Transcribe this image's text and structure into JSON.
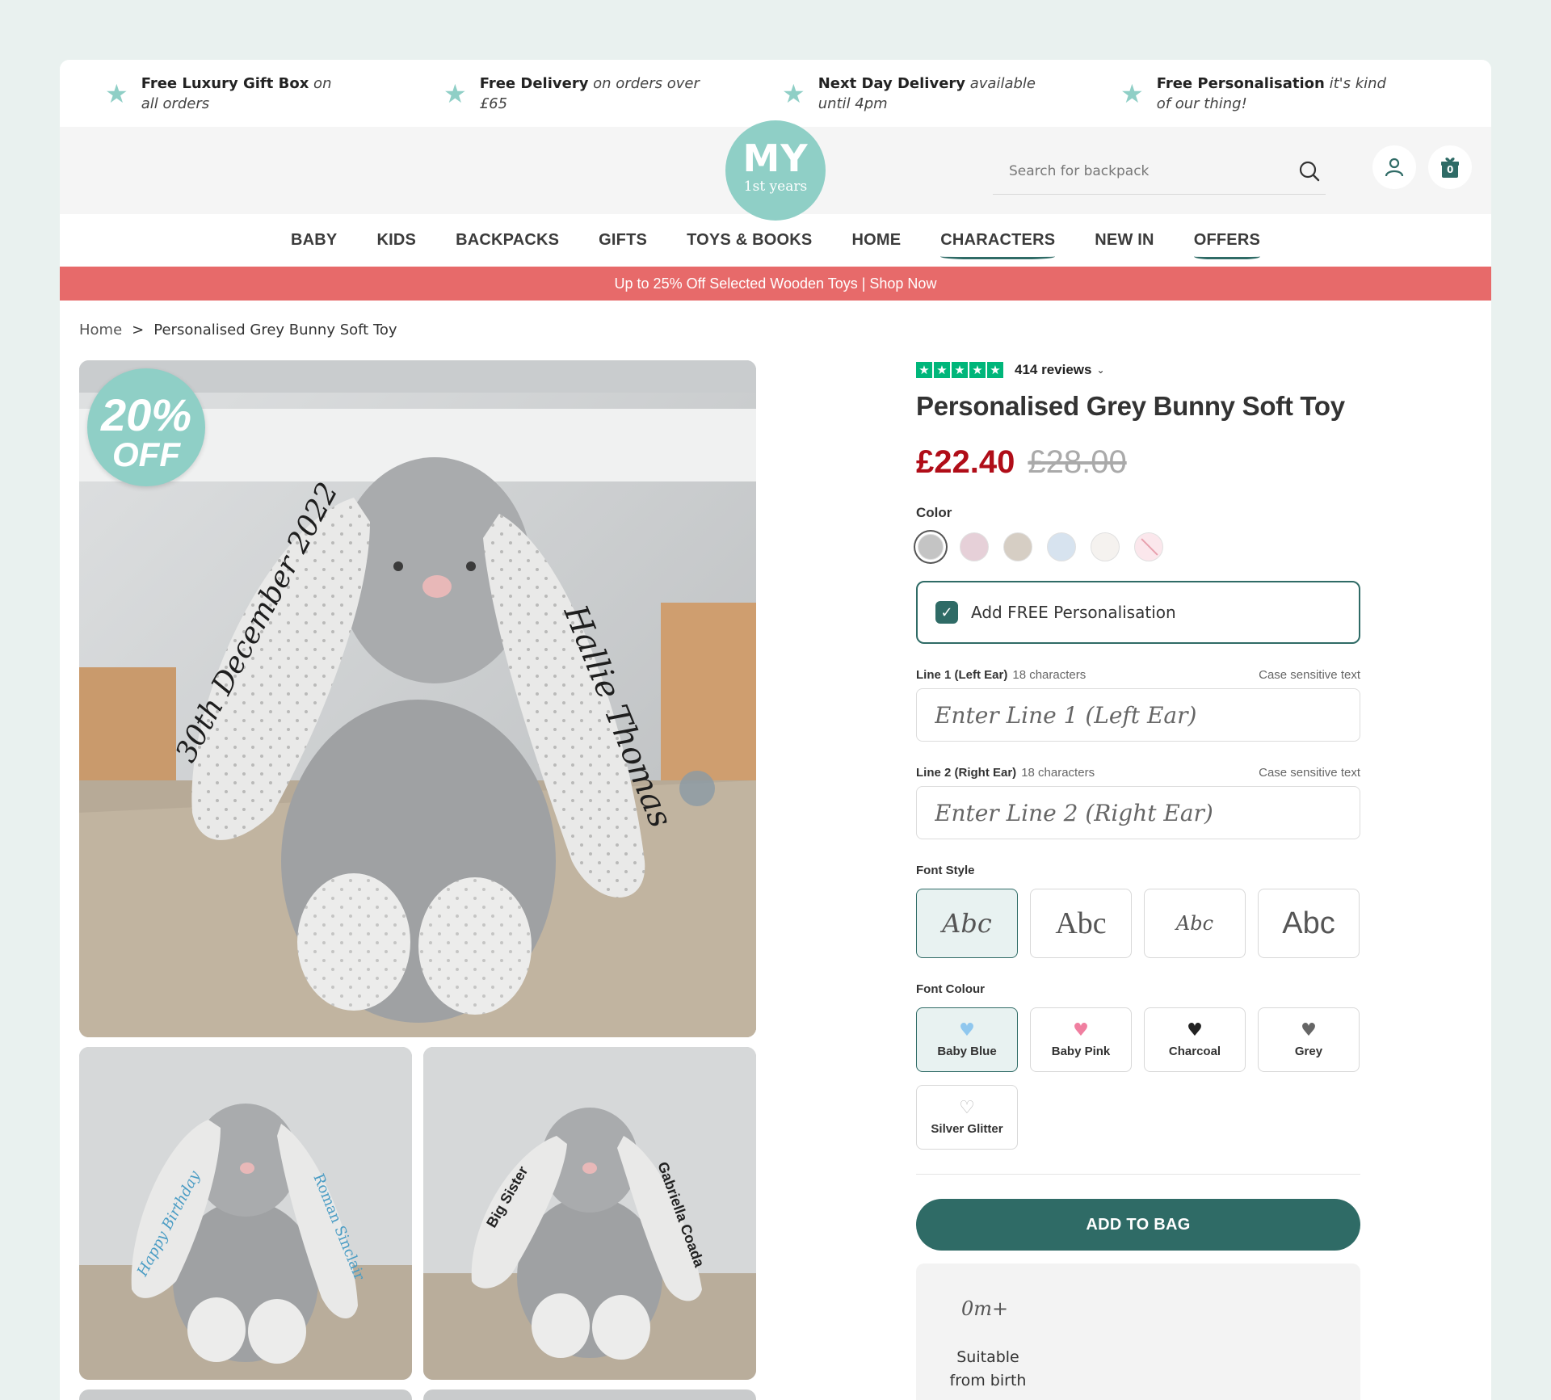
{
  "usps": [
    {
      "bold": "Free Luxury Gift Box",
      "rest": " on all orders"
    },
    {
      "bold": "Free Delivery",
      "rest": " on orders over £65"
    },
    {
      "bold": "Next Day Delivery",
      "rest": " available until 4pm"
    },
    {
      "bold": "Free Personalisation",
      "rest": " it's kind of our thing!"
    }
  ],
  "logo": {
    "big": "MY",
    "small": "1st years"
  },
  "search": {
    "placeholder": "Search for backpack"
  },
  "header": {
    "cart_count": "0"
  },
  "nav": [
    "BABY",
    "KIDS",
    "BACKPACKS",
    "GIFTS",
    "TOYS & BOOKS",
    "HOME",
    "CHARACTERS",
    "NEW IN",
    "OFFERS"
  ],
  "promo": "Up to 25% Off Selected Wooden Toys | Shop Now",
  "breadcrumb": {
    "home": "Home",
    "sep": ">",
    "current": "Personalised Grey Bunny Soft Toy"
  },
  "badge": {
    "pct": "20%",
    "off": "OFF"
  },
  "gallery": {
    "main_left_ear": "30th December 2022",
    "main_right_ear": "Hallie Thomas",
    "thumb1_left": "Happy Birthday",
    "thumb1_right": "Roman Sinclair",
    "thumb2_left": "Big Sister",
    "thumb2_right": "Gabriella Coada"
  },
  "product": {
    "reviews": "414 reviews",
    "title": "Personalised Grey Bunny Soft Toy",
    "price_now": "£22.40",
    "price_was": "£28.00",
    "color_label": "Color",
    "swatches": [
      "#c4c4c4",
      "#e6d0d8",
      "#d6cec4",
      "#d7e3ef",
      "#f5f2ef",
      "#fbe7ec"
    ],
    "personalise_label": "Add FREE Personalisation",
    "line1": {
      "label": "Line 1 (Left Ear)",
      "chars": "18 characters",
      "note": "Case sensitive text",
      "placeholder": "Enter Line 1 (Left Ear)"
    },
    "line2": {
      "label": "Line 2 (Right Ear)",
      "chars": "18 characters",
      "note": "Case sensitive text",
      "placeholder": "Enter Line 2 (Right Ear)"
    },
    "font_style_label": "Font Style",
    "font_styles": [
      "Abc",
      "Abc",
      "Abc",
      "Abc"
    ],
    "font_colour_label": "Font Colour",
    "font_colours": [
      {
        "name": "Baby Blue",
        "color": "#8fc7ee"
      },
      {
        "name": "Baby Pink",
        "color": "#f07fa0"
      },
      {
        "name": "Charcoal",
        "color": "#222222"
      },
      {
        "name": "Grey",
        "color": "#666666"
      },
      {
        "name": "Silver Glitter",
        "color": "#bbbbbb"
      }
    ],
    "add_to_bag": "ADD TO BAG",
    "age": "0m+",
    "suitable": "Suitable from birth"
  }
}
